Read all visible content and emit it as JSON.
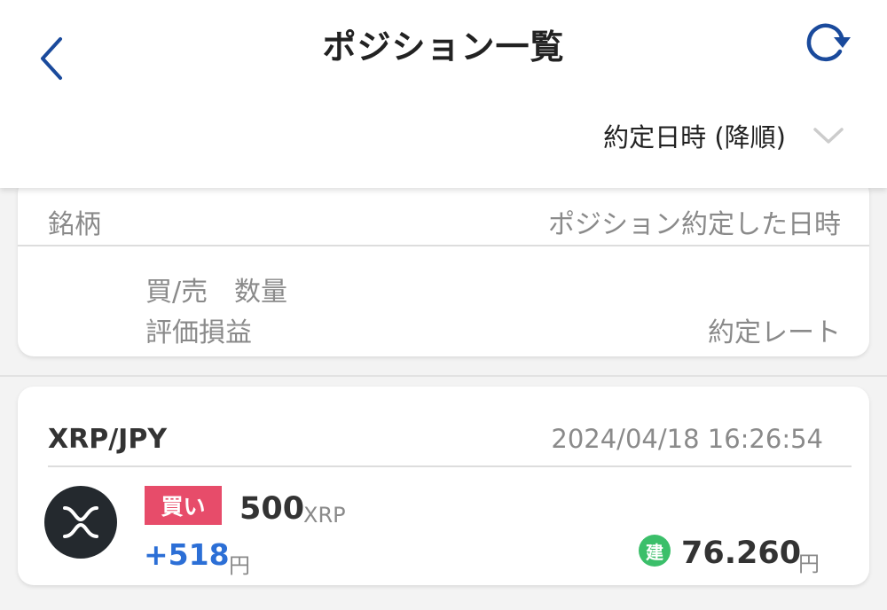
{
  "header": {
    "title": "ポジション一覧",
    "back_icon": "chevron-left-icon",
    "refresh_icon": "refresh-icon",
    "accent_color": "#1a4a9c"
  },
  "sort": {
    "selected": "約定日時 (降順)",
    "icon": "chevron-down-icon"
  },
  "legend": {
    "symbol": "銘柄",
    "datetime": "ポジション約定した日時",
    "side": "買/売",
    "quantity": "数量",
    "pnl": "評価損益",
    "rate": "約定レート"
  },
  "positions": [
    {
      "symbol": "XRP/JPY",
      "datetime": "2024/04/18 16:26:54",
      "coin_icon": "xrp-icon",
      "side": "買い",
      "quantity": "500",
      "quantity_unit": "XRP",
      "pnl": "+518",
      "pnl_unit": "円",
      "open_badge": "建",
      "rate": "76.260",
      "rate_unit": "円",
      "side_color": "#e74c6a",
      "pnl_color": "#2c6fd6",
      "open_badge_color": "#3bbf6a"
    }
  ]
}
